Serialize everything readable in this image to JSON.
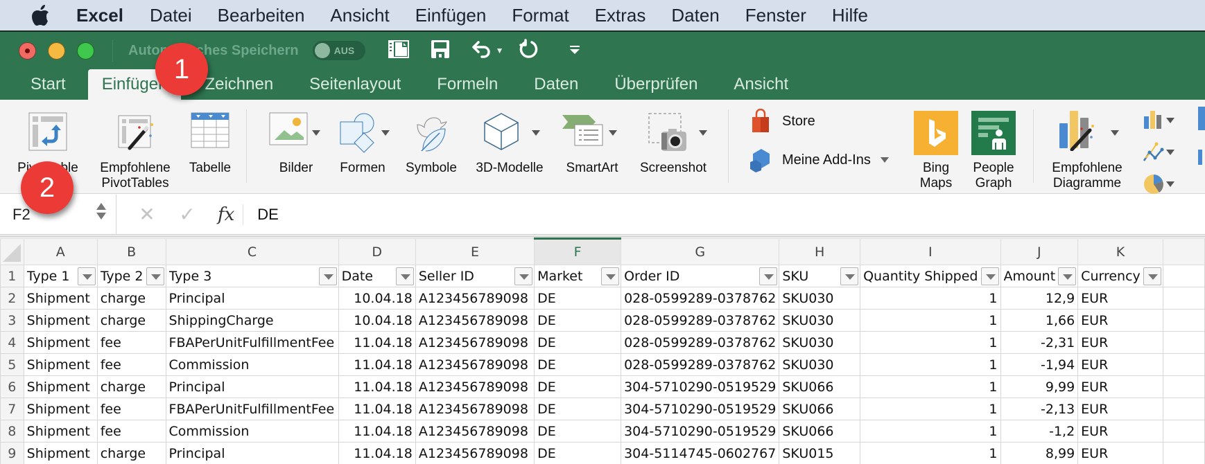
{
  "menubar": {
    "app": "Excel",
    "items": [
      "Datei",
      "Bearbeiten",
      "Ansicht",
      "Einfügen",
      "Format",
      "Extras",
      "Daten",
      "Fenster",
      "Hilfe"
    ]
  },
  "titlebar": {
    "autosave_label": "Automatisches Speichern",
    "autosave_state": "AUS"
  },
  "tabs": [
    {
      "label": "Start",
      "active": false
    },
    {
      "label": "Einfügen",
      "active": true
    },
    {
      "label": "Zeichnen",
      "active": false
    },
    {
      "label": "Seitenlayout",
      "active": false
    },
    {
      "label": "Formeln",
      "active": false
    },
    {
      "label": "Daten",
      "active": false
    },
    {
      "label": "Überprüfen",
      "active": false
    },
    {
      "label": "Ansicht",
      "active": false
    }
  ],
  "ribbon": {
    "pivottable": "PivotTable",
    "recommended_pivot_1": "Empfohlene",
    "recommended_pivot_2": "PivotTables",
    "table": "Tabelle",
    "pictures": "Bilder",
    "shapes": "Formen",
    "icons": "Symbole",
    "models3d": "3D-Modelle",
    "smartart": "SmartArt",
    "screenshot": "Screenshot",
    "store": "Store",
    "my_addins": "Meine Add-Ins",
    "bing_1": "Bing",
    "bing_2": "Maps",
    "people_1": "People",
    "people_2": "Graph",
    "rec_charts_1": "Empfohlene",
    "rec_charts_2": "Diagramme"
  },
  "formula_bar": {
    "name_box": "F2",
    "cancel_icon": "✕",
    "enter_icon": "✓",
    "fx": "fx",
    "value": "DE"
  },
  "badges": [
    "1",
    "2"
  ],
  "sheet": {
    "selected_column": "F",
    "columns": [
      "A",
      "B",
      "C",
      "D",
      "E",
      "F",
      "G",
      "H",
      "I",
      "J",
      "K",
      ""
    ],
    "headers": [
      "Type 1",
      "Type 2",
      "Type 3",
      "Date",
      "Seller ID",
      "Market",
      "Order ID",
      "SKU",
      "Quantity Shipped",
      "Amount",
      "Currency"
    ],
    "rows": [
      {
        "n": "2",
        "cells": [
          "Shipment",
          "charge",
          "Principal",
          "10.04.18",
          "A123456789098",
          "DE",
          "028-0599289-0378762",
          "SKU030",
          "1",
          "12,9",
          "EUR"
        ]
      },
      {
        "n": "3",
        "cells": [
          "Shipment",
          "charge",
          "ShippingCharge",
          "10.04.18",
          "A123456789098",
          "DE",
          "028-0599289-0378762",
          "SKU030",
          "1",
          "1,66",
          "EUR"
        ]
      },
      {
        "n": "4",
        "cells": [
          "Shipment",
          "fee",
          "FBAPerUnitFulfillmentFee",
          "11.04.18",
          "A123456789098",
          "DE",
          "028-0599289-0378762",
          "SKU030",
          "1",
          "-2,31",
          "EUR"
        ]
      },
      {
        "n": "5",
        "cells": [
          "Shipment",
          "fee",
          "Commission",
          "11.04.18",
          "A123456789098",
          "DE",
          "028-0599289-0378762",
          "SKU030",
          "1",
          "-1,94",
          "EUR"
        ]
      },
      {
        "n": "6",
        "cells": [
          "Shipment",
          "charge",
          "Principal",
          "11.04.18",
          "A123456789098",
          "DE",
          "304-5710290-0519529",
          "SKU066",
          "1",
          "9,99",
          "EUR"
        ]
      },
      {
        "n": "7",
        "cells": [
          "Shipment",
          "fee",
          "FBAPerUnitFulfillmentFee",
          "11.04.18",
          "A123456789098",
          "DE",
          "304-5710290-0519529",
          "SKU066",
          "1",
          "-2,13",
          "EUR"
        ]
      },
      {
        "n": "8",
        "cells": [
          "Shipment",
          "fee",
          "Commission",
          "11.04.18",
          "A123456789098",
          "DE",
          "304-5710290-0519529",
          "SKU066",
          "1",
          "-1,2",
          "EUR"
        ]
      },
      {
        "n": "9",
        "cells": [
          "Shipment",
          "charge",
          "Principal",
          "11.04.18",
          "A123456789098",
          "DE",
          "304-5114745-0602767",
          "SKU015",
          "1",
          "8,99",
          "EUR"
        ]
      }
    ]
  },
  "colors": {
    "excel_green": "#2e7550",
    "badge_red": "#ec3b36"
  }
}
